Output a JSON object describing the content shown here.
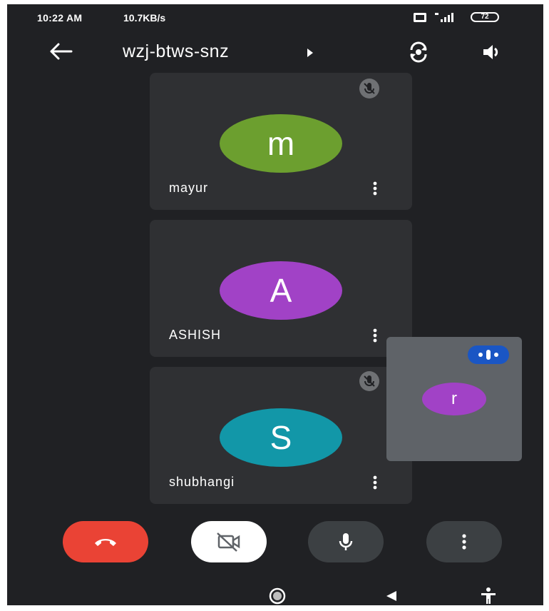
{
  "status_bar": {
    "time": "10:22 AM",
    "network_speed": "10.7KB/s",
    "volte": "VoLTE",
    "signal_label": "4G",
    "battery": "72"
  },
  "app_bar": {
    "meeting_code": "wzj-btws-snz",
    "back_icon": "back-arrow-icon",
    "switch_camera_icon": "switch-camera-icon",
    "speaker_icon": "speaker-icon"
  },
  "participants": [
    {
      "name": "mayur",
      "initial": "m",
      "color": "#6c9f2f",
      "muted": true
    },
    {
      "name": "ASHISH",
      "initial": "A",
      "color": "#a142c6",
      "muted": false
    },
    {
      "name": "shubhangi",
      "initial": "S",
      "color": "#1297a8",
      "muted": true
    }
  ],
  "self_view": {
    "initial": "r",
    "color": "#a142c6",
    "speaking": true
  },
  "controls": {
    "end_call_color": "#ea4335",
    "camera_state": "off",
    "mic_state": "on"
  },
  "nav_bar": {
    "home_icon": "home-circle-icon",
    "back_icon": "back-triangle-icon",
    "accessibility_icon": "accessibility-icon"
  }
}
